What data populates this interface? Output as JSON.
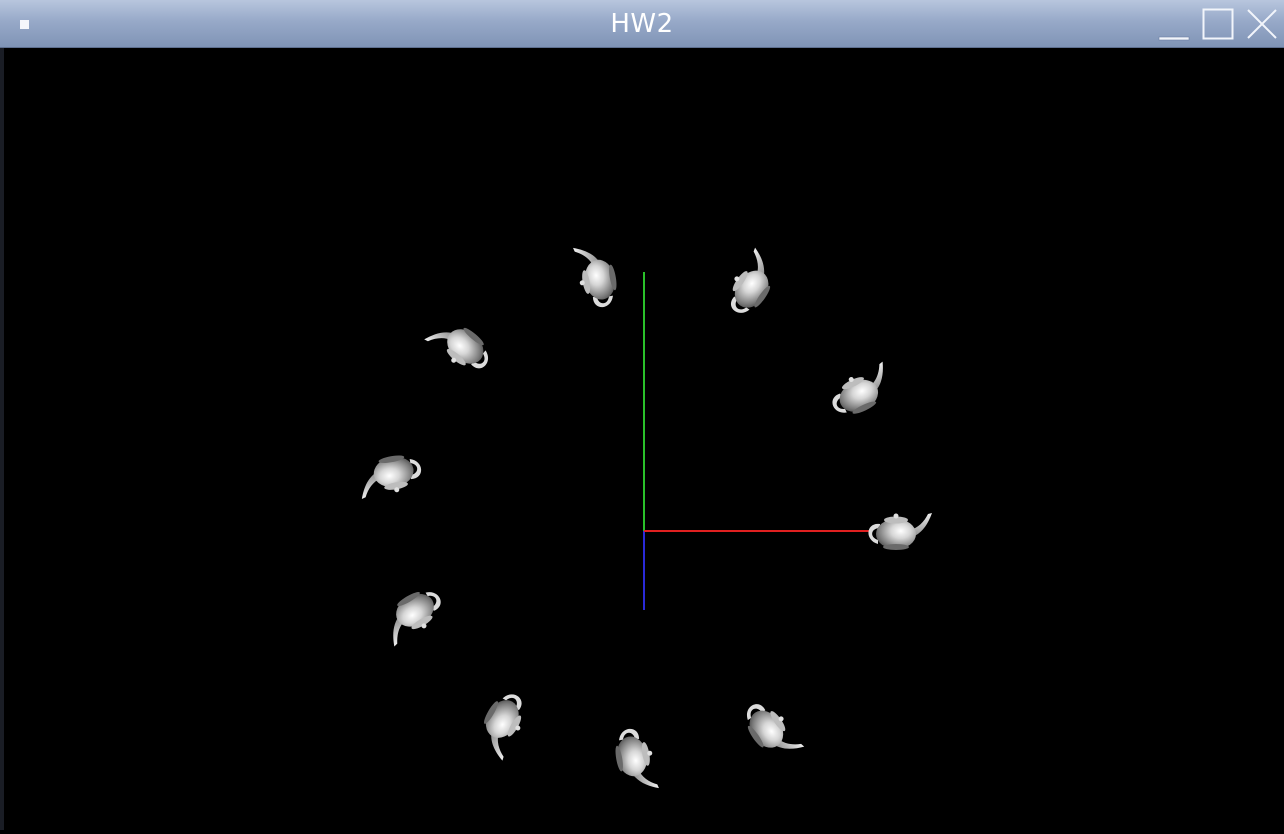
{
  "window": {
    "title": "HW2",
    "controls": {
      "minimize_icon": "minimize-icon",
      "maximize_icon": "maximize-icon",
      "close_icon": "close-icon"
    }
  },
  "scene": {
    "background": "#000000",
    "axes": {
      "x_color": "#e02020",
      "y_color": "#2ac02a",
      "z_color": "#2a2ad8"
    },
    "teapot_color": "#c8c8c8",
    "teapot_count": 10
  }
}
